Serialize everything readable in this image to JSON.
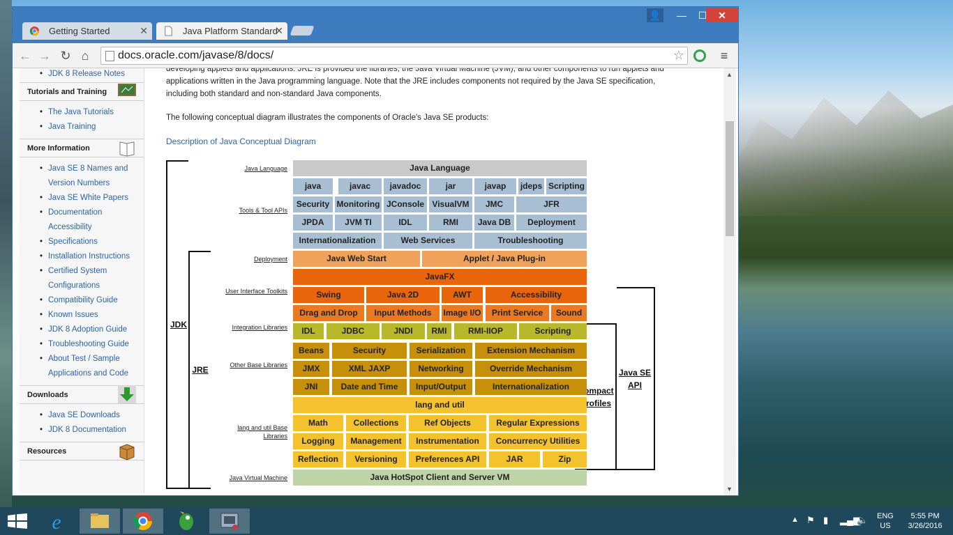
{
  "browser": {
    "tabs": [
      {
        "title": "Getting Started"
      },
      {
        "title": "Java Platform Standard Ed"
      }
    ],
    "url": "docs.oracle.com/javase/8/docs/"
  },
  "sidebar": {
    "top_item": "JDK 8 Release Notes",
    "sections": [
      {
        "title": "Tutorials and Training",
        "icon": "chalkboard-icon",
        "items": [
          "The Java Tutorials",
          "Java Training"
        ]
      },
      {
        "title": "More Information",
        "icon": "book-icon",
        "items": [
          "Java SE 8 Names and Version Numbers",
          "Java SE White Papers",
          "Documentation Accessibility",
          "Specifications",
          "Installation Instructions",
          "Certified System Configurations",
          "Compatibility Guide",
          "Known Issues",
          "JDK 8 Adoption Guide",
          "Troubleshooting Guide",
          "About Test / Sample Applications and Code"
        ]
      },
      {
        "title": "Downloads",
        "icon": "download-arrow-icon",
        "items": [
          "Java SE Downloads",
          "JDK 8 Documentation"
        ]
      },
      {
        "title": "Resources",
        "icon": "box-icon",
        "items": []
      }
    ]
  },
  "content": {
    "para1_line0": "developing applets and applications. JRE is provided the libraries, the Java Virtual Machine (JVM), and other components to run applets and",
    "para1_line1": "applications written in the Java programming language. Note that the JRE includes components not required by the Java SE specification,",
    "para1_line2": "including both standard and non-standard Java components.",
    "para2": "The following conceptual diagram illustrates the components of Oracle's Java SE products:",
    "link": "Description of Java Conceptual Diagram"
  },
  "diagram": {
    "row_labels": [
      "Java Language",
      "Tools & Tool APIs",
      "Deployment",
      "User Interface Toolkits",
      "Integration Libraries",
      "Other Base Libraries",
      "lang and util Base Libraries",
      "Java Virtual Machine"
    ],
    "rows": [
      [
        "Java Language"
      ],
      [
        "java",
        "javac",
        "javadoc",
        "jar",
        "javap",
        "jdeps",
        "Scripting"
      ],
      [
        "Security",
        "Monitoring",
        "JConsole",
        "VisualVM",
        "JMC",
        "JFR"
      ],
      [
        "JPDA",
        "JVM TI",
        "IDL",
        "RMI",
        "Java DB",
        "Deployment"
      ],
      [
        "Internationalization",
        "Web Services",
        "Troubleshooting"
      ],
      [
        "Java Web Start",
        "Applet / Java Plug-in"
      ],
      [
        "JavaFX"
      ],
      [
        "Swing",
        "Java 2D",
        "AWT",
        "Accessibility"
      ],
      [
        "Drag and Drop",
        "Input Methods",
        "Image I/O",
        "Print Service",
        "Sound"
      ],
      [
        "IDL",
        "JDBC",
        "JNDI",
        "RMI",
        "RMI-IIOP",
        "Scripting"
      ],
      [
        "Beans",
        "Security",
        "Serialization",
        "Extension Mechanism"
      ],
      [
        "JMX",
        "XML JAXP",
        "Networking",
        "Override Mechanism"
      ],
      [
        "JNI",
        "Date and Time",
        "Input/Output",
        "Internationalization"
      ],
      [
        "lang and util"
      ],
      [
        "Math",
        "Collections",
        "Ref Objects",
        "Regular Expressions"
      ],
      [
        "Logging",
        "Management",
        "Instrumentation",
        "Concurrency Utilities"
      ],
      [
        "Reflection",
        "Versioning",
        "Preferences API",
        "JAR",
        "Zip"
      ],
      [
        "Java HotSpot Client and Server VM"
      ]
    ],
    "brackets": {
      "jdk": "JDK",
      "jre": "JRE",
      "compact": "Compact Profiles",
      "api": "Java SE API"
    }
  },
  "taskbar": {
    "lang": "ENG",
    "region": "US",
    "time": "5:55 PM",
    "date": "3/26/2016"
  }
}
